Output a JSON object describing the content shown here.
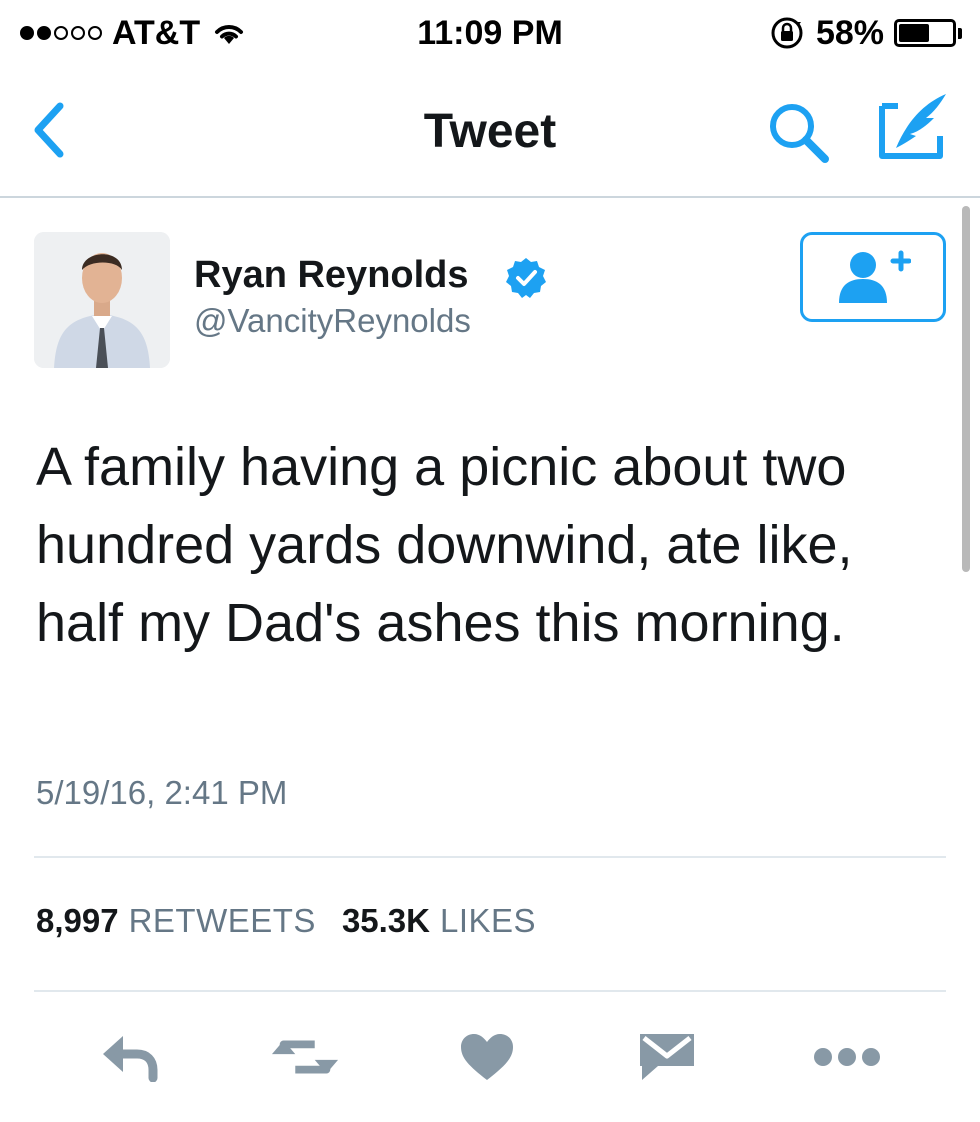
{
  "status_bar": {
    "carrier": "AT&T",
    "time": "11:09 PM",
    "battery_percent": "58%",
    "battery_level": 0.58,
    "signal_bars_filled": 2,
    "signal_bars_total": 5
  },
  "nav": {
    "title": "Tweet"
  },
  "tweet": {
    "author_name": "Ryan Reynolds",
    "author_handle": "@VancityReynolds",
    "text": "A family having a picnic about two hundred yards downwind, ate like, half my Dad's ashes this morning.",
    "timestamp": "5/19/16, 2:41 PM",
    "retweets_count": "8,997",
    "retweets_label": "RETWEETS",
    "likes_count": "35.3K",
    "likes_label": "LIKES"
  },
  "colors": {
    "accent": "#1da1f2",
    "text_primary": "#14171a",
    "text_secondary": "#657786",
    "action_icon": "#8899a6",
    "divider": "#e1e8ed"
  },
  "icons": {
    "back": "chevron-left-icon",
    "search": "search-icon",
    "compose": "compose-icon",
    "verified": "verified-badge-icon",
    "follow": "add-user-icon",
    "reply": "reply-icon",
    "retweet": "retweet-icon",
    "like": "heart-icon",
    "dm": "envelope-icon",
    "more": "more-dots-icon"
  }
}
